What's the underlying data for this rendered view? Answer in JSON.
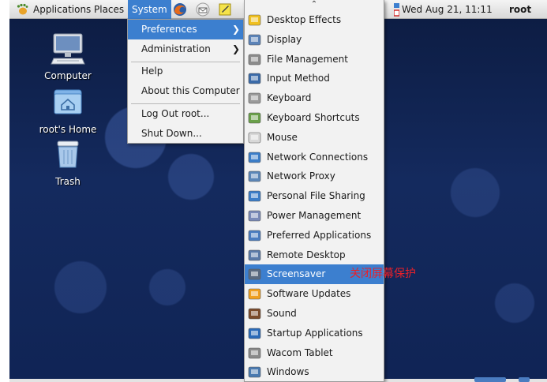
{
  "top_panel": {
    "applications": "Applications",
    "places": "Places",
    "system": "System",
    "clock": "Wed Aug 21, 11:11",
    "user": "root"
  },
  "desktop": {
    "icons": [
      {
        "label": "Computer",
        "icon": "computer-icon"
      },
      {
        "label": "root's Home",
        "icon": "home-folder-icon"
      },
      {
        "label": "Trash",
        "icon": "trash-icon"
      }
    ]
  },
  "system_menu": {
    "items": [
      {
        "label": "Preferences",
        "submenu": true,
        "active": true
      },
      {
        "label": "Administration",
        "submenu": true,
        "active": false
      },
      {
        "label": "Help",
        "submenu": false,
        "active": false
      },
      {
        "label": "About this Computer",
        "submenu": false,
        "active": false
      },
      {
        "label": "Log Out root...",
        "submenu": false,
        "active": false
      },
      {
        "label": "Shut Down...",
        "submenu": false,
        "active": false
      }
    ],
    "submenu_arrow": "❯"
  },
  "preferences_menu": {
    "scroll_up": "⌃",
    "items": [
      {
        "label": "Desktop Effects",
        "icon": "desktop-effects-icon"
      },
      {
        "label": "Display",
        "icon": "display-icon"
      },
      {
        "label": "File Management",
        "icon": "file-management-icon"
      },
      {
        "label": "Input Method",
        "icon": "input-method-icon"
      },
      {
        "label": "Keyboard",
        "icon": "keyboard-icon"
      },
      {
        "label": "Keyboard Shortcuts",
        "icon": "keyboard-shortcuts-icon"
      },
      {
        "label": "Mouse",
        "icon": "mouse-icon"
      },
      {
        "label": "Network Connections",
        "icon": "network-connections-icon"
      },
      {
        "label": "Network Proxy",
        "icon": "network-proxy-icon"
      },
      {
        "label": "Personal File Sharing",
        "icon": "file-sharing-icon"
      },
      {
        "label": "Power Management",
        "icon": "power-management-icon"
      },
      {
        "label": "Preferred Applications",
        "icon": "preferred-applications-icon"
      },
      {
        "label": "Remote Desktop",
        "icon": "remote-desktop-icon"
      },
      {
        "label": "Screensaver",
        "icon": "screensaver-icon",
        "active": true
      },
      {
        "label": "Software Updates",
        "icon": "software-updates-icon"
      },
      {
        "label": "Sound",
        "icon": "sound-icon"
      },
      {
        "label": "Startup Applications",
        "icon": "startup-applications-icon"
      },
      {
        "label": "Wacom Tablet",
        "icon": "wacom-tablet-icon"
      },
      {
        "label": "Windows",
        "icon": "windows-icon"
      }
    ]
  },
  "annotation": "关闭屏幕保护",
  "colors": {
    "highlight": "#3c7fcf",
    "annotation": "#e8202a",
    "desktop_bg": "#142a5e"
  }
}
